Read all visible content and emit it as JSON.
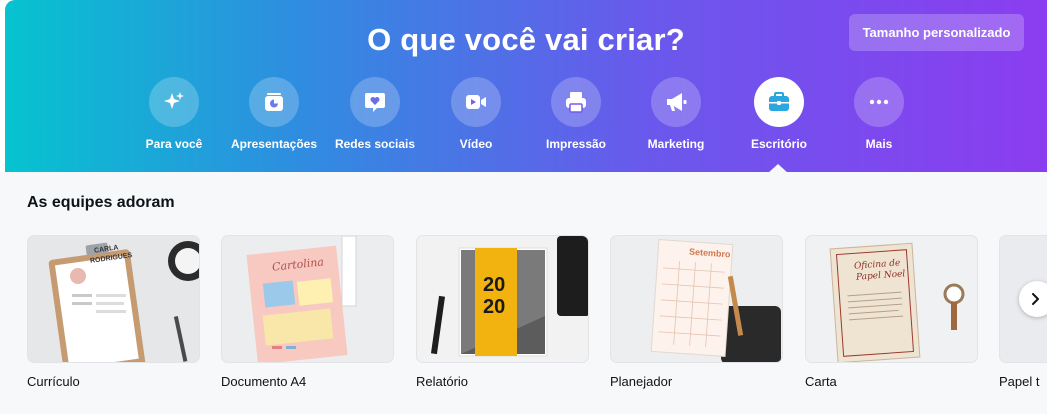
{
  "hero": {
    "title": "O que você vai criar?",
    "custom_size_label": "Tamanho personalizado"
  },
  "categories": [
    {
      "label": "Para você",
      "icon": "sparkle-icon",
      "active": false
    },
    {
      "label": "Apresentações",
      "icon": "presentation-icon",
      "active": false
    },
    {
      "label": "Redes sociais",
      "icon": "heart-chat-icon",
      "active": false
    },
    {
      "label": "Vídeo",
      "icon": "video-camera-icon",
      "active": false
    },
    {
      "label": "Impressão",
      "icon": "printer-icon",
      "active": false
    },
    {
      "label": "Marketing",
      "icon": "megaphone-icon",
      "active": false
    },
    {
      "label": "Escritório",
      "icon": "briefcase-icon",
      "active": true
    },
    {
      "label": "Mais",
      "icon": "more-dots-icon",
      "active": false
    }
  ],
  "section": {
    "title": "As equipes adoram",
    "cards": [
      {
        "label": "Currículo",
        "thumb_text": [
          "CARLA",
          "RODRIGUES"
        ]
      },
      {
        "label": "Documento A4",
        "thumb_text": [
          "Cartolina"
        ]
      },
      {
        "label": "Relatório",
        "thumb_text": [
          "20",
          "20"
        ]
      },
      {
        "label": "Planejador",
        "thumb_text": [
          "Setembro"
        ]
      },
      {
        "label": "Carta",
        "thumb_text": [
          "Oficina de",
          "Papel Noel"
        ]
      },
      {
        "label": "Papel t"
      }
    ]
  },
  "colors": {
    "gradient_start": "#06c3cf",
    "gradient_end": "#8b3df0",
    "active_icon": "#2aa7e0"
  }
}
